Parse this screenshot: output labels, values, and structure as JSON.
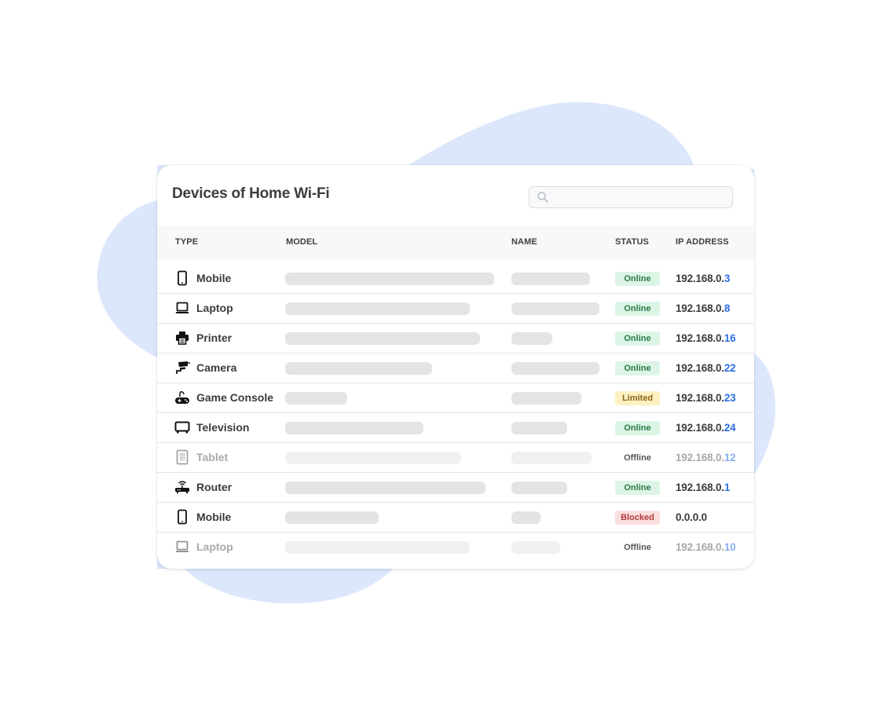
{
  "colors": {
    "blob": "#dce7fb",
    "accent_ip": "#2f6fe4",
    "online_bg": "#dcf5e6",
    "limited_bg": "#fdf1c2",
    "blocked_bg": "#fbdede"
  },
  "card": {
    "title": "Devices of Home Wi-Fi",
    "search": {
      "placeholder": "",
      "value": "",
      "icon": "search-icon"
    }
  },
  "table": {
    "columns": [
      "TYPE",
      "MODEL",
      "NAME",
      "STATUS",
      "IP ADDRESS"
    ],
    "rows": [
      {
        "type": "Mobile",
        "icon": "mobile-icon",
        "status": "Online",
        "ip_prefix": "192.168.0.",
        "ip_suffix": "3",
        "dim": false
      },
      {
        "type": "Laptop",
        "icon": "laptop-icon",
        "status": "Online",
        "ip_prefix": "192.168.0.",
        "ip_suffix": "8",
        "dim": false
      },
      {
        "type": "Printer",
        "icon": "printer-icon",
        "status": "Online",
        "ip_prefix": "192.168.0.",
        "ip_suffix": "16",
        "dim": false
      },
      {
        "type": "Camera",
        "icon": "camera-icon",
        "status": "Online",
        "ip_prefix": "192.168.0.",
        "ip_suffix": "22",
        "dim": false
      },
      {
        "type": "Game Console",
        "icon": "game-console-icon",
        "status": "Limited",
        "ip_prefix": "192.168.0.",
        "ip_suffix": "23",
        "dim": false
      },
      {
        "type": "Television",
        "icon": "television-icon",
        "status": "Online",
        "ip_prefix": "192.168.0.",
        "ip_suffix": "24",
        "dim": false
      },
      {
        "type": "Tablet",
        "icon": "tablet-icon",
        "status": "Offline",
        "ip_prefix": "192.168.0.",
        "ip_suffix": "12",
        "dim": true
      },
      {
        "type": "Router",
        "icon": "router-icon",
        "status": "Online",
        "ip_prefix": "192.168.0.",
        "ip_suffix": "1",
        "dim": false
      },
      {
        "type": "Mobile",
        "icon": "mobile-icon",
        "status": "Blocked",
        "ip_prefix": "0.0.0.0",
        "ip_suffix": "",
        "dim": false
      },
      {
        "type": "Laptop",
        "icon": "laptop-icon",
        "status": "Offline",
        "ip_prefix": "192.168.0.",
        "ip_suffix": "10",
        "dim": true
      }
    ]
  }
}
